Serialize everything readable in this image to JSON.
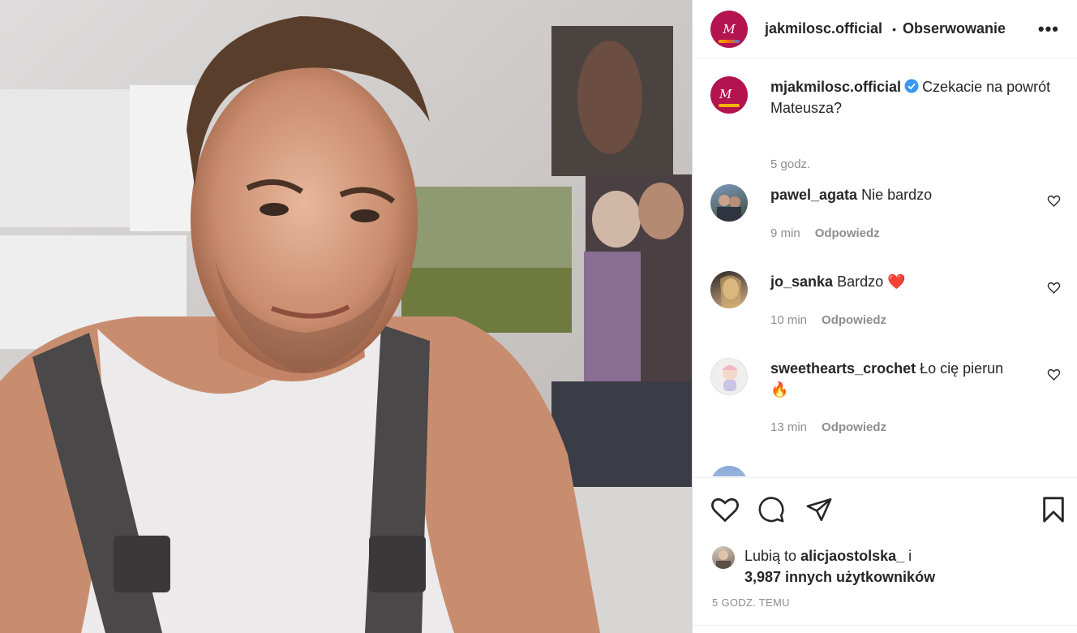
{
  "header": {
    "username": "jakmilosc.official",
    "separator": "•",
    "follow_label": "Obserwowanie",
    "more_label": "•••",
    "avatar_logo_text": "M jak Miłość"
  },
  "caption": {
    "username": "mjakmilosc.official",
    "text": "Czekacie na powrót Mateusza?",
    "time": "5 godz."
  },
  "comments": [
    {
      "username": "pawel_agata",
      "text": "Nie bardzo",
      "emoji": "",
      "time": "9 min",
      "reply_label": "Odpowiedz"
    },
    {
      "username": "jo_sanka",
      "text": "Bardzo",
      "emoji": "❤️",
      "time": "10 min",
      "reply_label": "Odpowiedz"
    },
    {
      "username": "sweethearts_crochet",
      "text": "Ło cię pierun",
      "emoji": "🔥",
      "time": "13 min",
      "reply_label": "Odpowiedz"
    }
  ],
  "likes": {
    "prefix": "Lubią to",
    "user": "alicjaostolska_",
    "conj": "i",
    "count_text": "3,987 innych użytkowników"
  },
  "posted_ago": "5 GODZ. TEMU",
  "colors": {
    "brand": "#b3134f",
    "verified": "#3897f0",
    "heart": "#ed4956"
  }
}
